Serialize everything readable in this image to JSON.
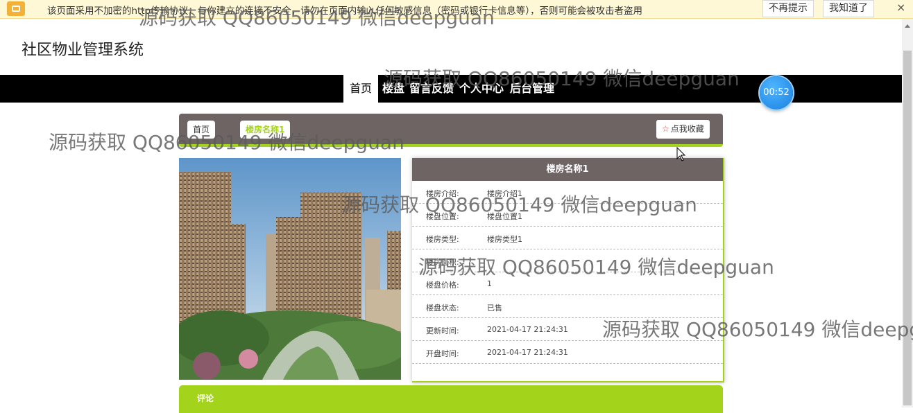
{
  "notice": {
    "text": "该页面采用不加密的http传输协议，与你建立的连接不安全，请勿在页面内输入任何敏感信息（密码或银行卡信息等），否则可能会被攻击者盗用",
    "dismiss_label": "不再提示",
    "ack_label": "我知道了",
    "close_label": "×"
  },
  "site": {
    "title": "社区物业管理系统"
  },
  "nav": {
    "items": [
      {
        "label": "首页",
        "active": true
      },
      {
        "label": "楼盘"
      },
      {
        "label": "留言反馈"
      },
      {
        "label": "个人中心"
      },
      {
        "label": "后台管理"
      }
    ]
  },
  "timer": "00:52",
  "breadcrumb": {
    "home": "首页",
    "sep": "/",
    "current": "楼房名称1"
  },
  "favorite_label": "点我收藏",
  "detail": {
    "title": "楼房名称1",
    "fields": [
      {
        "label": "楼房介绍:",
        "value": "楼房介绍1"
      },
      {
        "label": "楼盘位置:",
        "value": "楼盘位置1"
      },
      {
        "label": "楼房类型:",
        "value": "楼房类型1"
      },
      {
        "label": "楼房面积:",
        "value": ""
      },
      {
        "label": "楼盘价格:",
        "value": "1"
      },
      {
        "label": "楼盘状态:",
        "value": "已售"
      },
      {
        "label": "更新时间:",
        "value": "2021-04-17 21:24:31"
      },
      {
        "label": "开盘时间:",
        "value": "2021-04-17 21:24:31"
      }
    ]
  },
  "comment_label": "评论",
  "watermark": "源码获取 QQ86050149 微信deepguan",
  "colors": {
    "accent": "#a3d31b",
    "header_bg": "#6e6464",
    "nav_bg": "#000000"
  }
}
